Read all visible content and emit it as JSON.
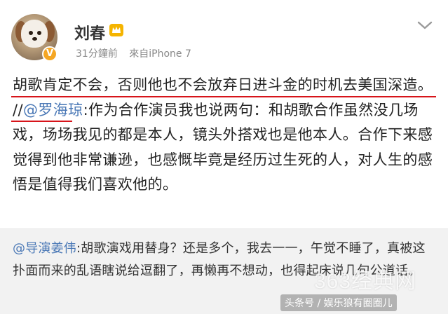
{
  "post": {
    "author": "刘春",
    "verified_badge": "V",
    "time": "31分鐘前",
    "device": "來自iPhone 7",
    "text_highlight": "胡歌肯定不会，否则他也不会放弃日进斗金的时机去美国深造。",
    "text_sep": " //",
    "mention": "@罗海琼",
    "text_rest": ":作为合作演员我也说两句：和胡歌合作虽然没几场戏，场场我见的都是本人，镜头外搭戏也是他本人。合作下来感觉得到他非常谦逊，也感慨毕竟是经历过生死的人，对人生的感悟是值得我们喜欢他的。"
  },
  "repost": {
    "mention": "@导演姜伟",
    "text": ":胡歌演戏用替身？还是多个，我去一一，午觉不睡了，真被这扑面而来的乱语瞎说给逗翻了，再懒再不想动，也得起床说几句公道话。"
  },
  "watermark": "363经典网",
  "source": "头条号 / 娱乐狼有圈圈儿",
  "icons": [
    "avatar",
    "crown-icon",
    "chevron-down-icon"
  ],
  "colors": {
    "underline": "#d7141a",
    "mention": "#4a78b6",
    "repost_bg": "#f2f2f2"
  }
}
